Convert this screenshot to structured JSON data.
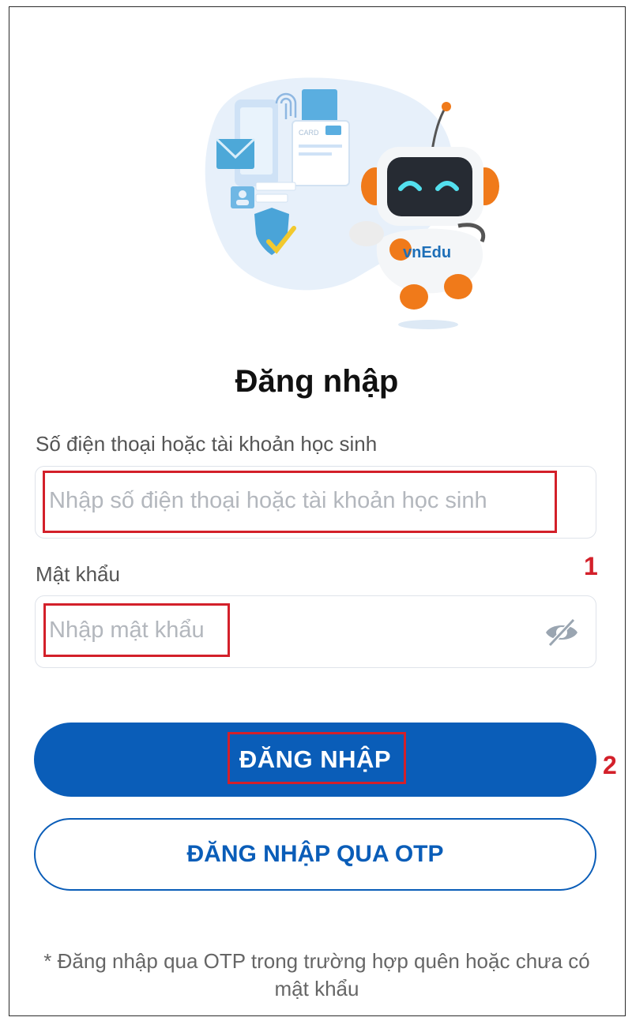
{
  "login": {
    "title": "Đăng nhập",
    "account_label": "Số điện thoại hoặc tài khoản học sinh",
    "account_placeholder": "Nhập số điện thoại hoặc tài khoản học sinh",
    "password_label": "Mật khẩu",
    "password_placeholder": "Nhập mật khẩu",
    "login_button": "ĐĂNG NHẬP",
    "otp_button": "ĐĂNG NHẬP QUA OTP",
    "note": "* Đăng nhập qua OTP trong trường hợp quên hoặc chưa có mật khẩu"
  },
  "illustration": {
    "robot_brand": "vnEdu",
    "card_text": "CARD"
  },
  "annotations": {
    "step1": "1",
    "step2": "2",
    "highlight_color": "#d3202a"
  },
  "colors": {
    "primary": "#0a5db8",
    "robot_orange": "#f07a1a"
  },
  "icons": {
    "password_toggle": "eye-slash-icon"
  }
}
